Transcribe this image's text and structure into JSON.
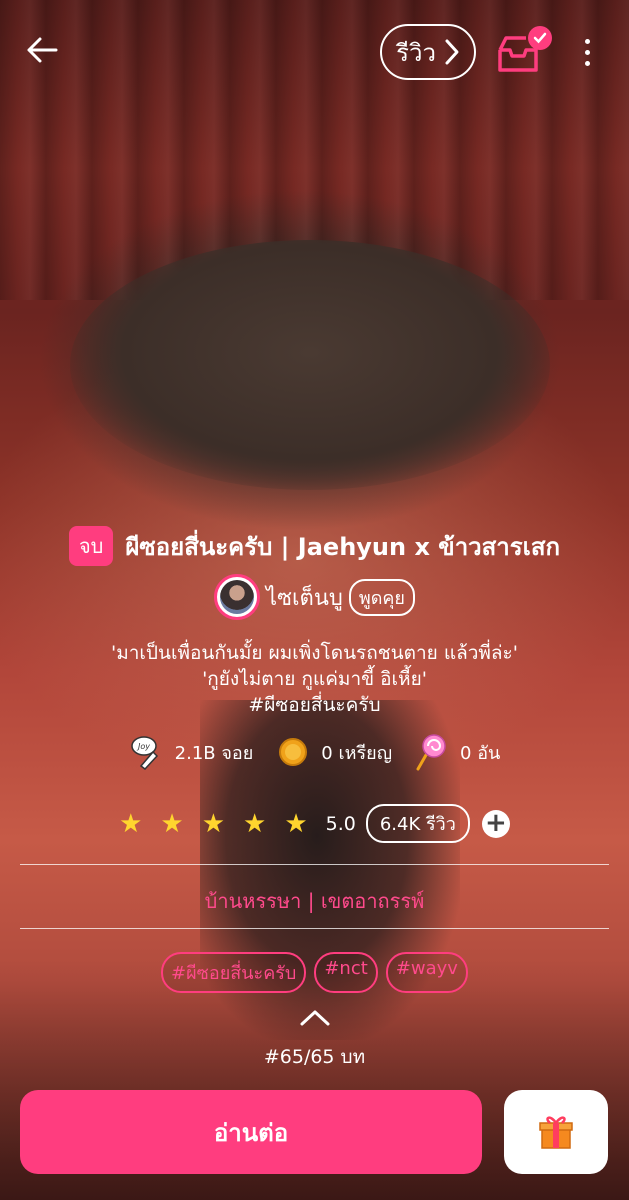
{
  "header": {
    "back_icon": "arrow-left-icon",
    "review_label": "รีวิว",
    "inbox_icon": "inbox-icon",
    "more_icon": "more-vertical-icon"
  },
  "story": {
    "status": "จบ",
    "title": "ผีซอยสี่นะครับ | Jaehyun x ข้าวสารเสก",
    "author": "ไซเต็นบู",
    "chat_label": "พูดคุย",
    "synopsis": [
      "'มาเป็นเพื่อนกันมั้ย ผมเพิ่งโดนรถชนตาย แล้วพี่ล่ะ'",
      "'กูยังไม่ตาย กูแค่มาขี้ อิเหี้ย'",
      "#ผีซอยสี่นะครับ"
    ]
  },
  "stats": {
    "joy": "2.1B จอย",
    "coins": "0 เหรียญ",
    "lollipops": "0 อัน"
  },
  "rating": {
    "stars": 5,
    "value": "5.0",
    "review_count": "6.4K รีวิว"
  },
  "genre": {
    "primary": "บ้านหรรษา",
    "separator": "|",
    "secondary": "เขตอาถรรพ์"
  },
  "tags": [
    "#ผีซอยสี่นะครับ",
    "#nct",
    "#wayv"
  ],
  "episodes": "#65/65 บท",
  "actions": {
    "read_label": "อ่านต่อ",
    "gift_icon": "gift-icon"
  },
  "colors": {
    "accent": "#ff3d7f",
    "star": "#ffd52e"
  }
}
